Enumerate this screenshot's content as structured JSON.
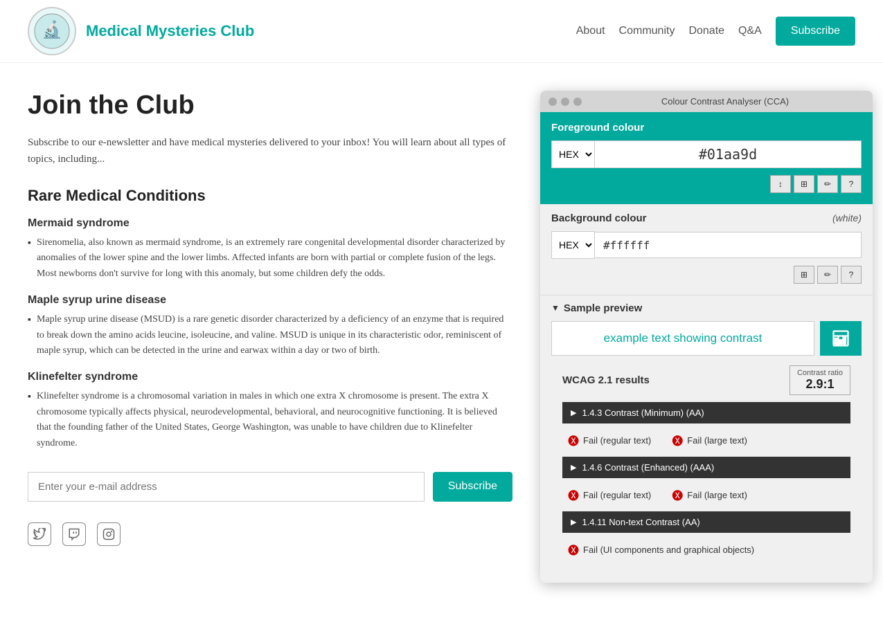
{
  "header": {
    "site_title": "Medical Mysteries Club",
    "nav": {
      "about": "About",
      "community": "Community",
      "donate": "Donate",
      "qa": "Q&A",
      "subscribe": "Subscribe"
    }
  },
  "main": {
    "page_title": "Join the Club",
    "intro": "Subscribe to our e-newsletter and have medical mysteries delivered to your inbox! You will learn about all types of topics, including...",
    "section_title": "Rare Medical Conditions",
    "conditions": [
      {
        "name": "Mermaid syndrome",
        "description": "Sirenomelia, also known as mermaid syndrome, is an extremely rare congenital developmental disorder characterized by anomalies of the lower spine and the lower limbs. Affected infants are born with partial or complete fusion of the legs. Most newborns don't survive for long with this anomaly, but some children defy the odds."
      },
      {
        "name": "Maple syrup urine disease",
        "description": "Maple syrup urine disease (MSUD) is a rare genetic disorder characterized by a deficiency of an enzyme that is required to break down the amino acids leucine, isoleucine, and valine. MSUD is unique in its characteristic odor, reminiscent of maple syrup, which can be detected in the urine and earwax within a day or two of birth."
      },
      {
        "name": "Klinefelter syndrome",
        "description": "Klinefelter syndrome is a chromosomal variation in males in which one extra X chromosome is present. The extra X chromosome typically affects physical, neurodevelopmental, behavioral, and neurocognitive functioning. It is believed that the founding father of the United States, George Washington, was unable to have children due to Klinefelter syndrome."
      }
    ],
    "email_placeholder": "Enter your e-mail address",
    "subscribe_label": "Subscribe"
  },
  "cca": {
    "title": "Colour Contrast Analyser (CCA)",
    "foreground_label": "Foreground colour",
    "foreground_format": "HEX",
    "foreground_value": "#01aa9d",
    "background_label": "Background colour",
    "background_white": "(white)",
    "background_format": "HEX",
    "background_value": "#ffffff",
    "sample_preview_label": "Sample preview",
    "sample_text": "example text showing contrast",
    "wcag_label": "WCAG 2.1 results",
    "contrast_ratio_label": "Contrast ratio",
    "contrast_ratio_value": "2.9:1",
    "rules": [
      {
        "id": "rule1",
        "label": "1.4.3 Contrast (Minimum) (AA)",
        "results": [
          {
            "type": "fail",
            "text": "Fail (regular text)"
          },
          {
            "type": "fail",
            "text": "Fail (large text)"
          }
        ]
      },
      {
        "id": "rule2",
        "label": "1.4.6 Contrast (Enhanced) (AAA)",
        "results": [
          {
            "type": "fail",
            "text": "Fail (regular text)"
          },
          {
            "type": "fail",
            "text": "Fail (large text)"
          }
        ]
      },
      {
        "id": "rule3",
        "label": "1.4.11 Non-text Contrast (AA)",
        "results": [
          {
            "type": "fail",
            "text": "Fail (UI components and graphical objects)"
          }
        ]
      }
    ],
    "tool_buttons": [
      "↕",
      "⊞",
      "✏",
      "?"
    ],
    "bg_tool_buttons": [
      "⊞",
      "✏",
      "?"
    ]
  }
}
